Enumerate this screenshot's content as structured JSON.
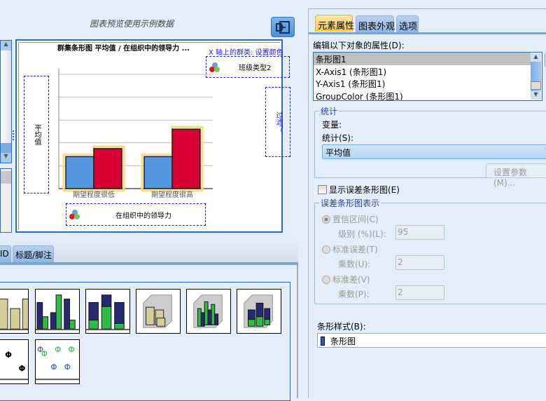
{
  "left_panel": {
    "preview_title": "图表预览使用示例数据",
    "collapse_button": "collapse-panel",
    "chart_preview": {
      "title": "群集条形图 平均值 / 在组织中的领导力 ...",
      "x_cluster_label": "X 轴上的群类: 设置颜色",
      "legend_variable": "班级类型2",
      "y_axis_label": "平均值",
      "right_drop_zone": "过滤？",
      "x_axis_variable": "在组织中的领导力"
    },
    "bottom_tabs": [
      {
        "label": "ID"
      },
      {
        "label": "标题/脚注"
      }
    ]
  },
  "chart_data": {
    "type": "bar",
    "categories": [
      "期望程度很低",
      "期望程度很高"
    ],
    "series": [
      {
        "color": "#5596e0",
        "values": [
          1.4,
          1.4
        ]
      },
      {
        "color": "#d80032",
        "values": [
          1.75,
          2.6
        ]
      }
    ],
    "ylim": [
      0,
      5
    ],
    "grid": true,
    "title": "群集条形图 平均值 / 在组织中的领导力 ...",
    "ylabel": "平均值",
    "xlabel": "在组织中的领导力"
  },
  "gallery": {
    "thumbnails": [
      "simple-bar",
      "clustered-bar",
      "stacked-bar",
      "3d-bar",
      "3d-clustered-bar",
      "3d-stacked-bar",
      "error-bar",
      "clustered-error-bar"
    ]
  },
  "right_panel": {
    "tabs": [
      {
        "label": "元素属性",
        "active": true
      },
      {
        "label": "图表外观"
      },
      {
        "label": "选项"
      }
    ],
    "edit_label": "编辑以下对象的属性(D):",
    "objects": [
      "条形图1",
      "X-Axis1 (条形图1)",
      "Y-Axis1 (条形图1)",
      "GroupColor (条形图1)"
    ],
    "selected_object": "条形图1",
    "statistics": {
      "group_label": "统计",
      "variable_label": "变量:",
      "stat_label": "统计(S):",
      "stat_value": "平均值",
      "params_button": "设置参数(M)..."
    },
    "show_error_bars": {
      "label": "显示误差条形图(E)",
      "checked": false
    },
    "error_bars": {
      "group_label": "误差条形图表示",
      "ci_label": "置信区间(C)",
      "level_label": "级别 (%)(L):",
      "level_value": "95",
      "se_label": "标准误差(T)",
      "se_mult_label": "乘数(U):",
      "se_mult_value": "2",
      "sd_label": "标准差(V)",
      "sd_mult_label": "乘数(P):",
      "sd_mult_value": "2"
    },
    "bar_style_label": "条形样式(B):",
    "bar_style_value": "条形图",
    "accent_color": "#2a6ac0"
  }
}
